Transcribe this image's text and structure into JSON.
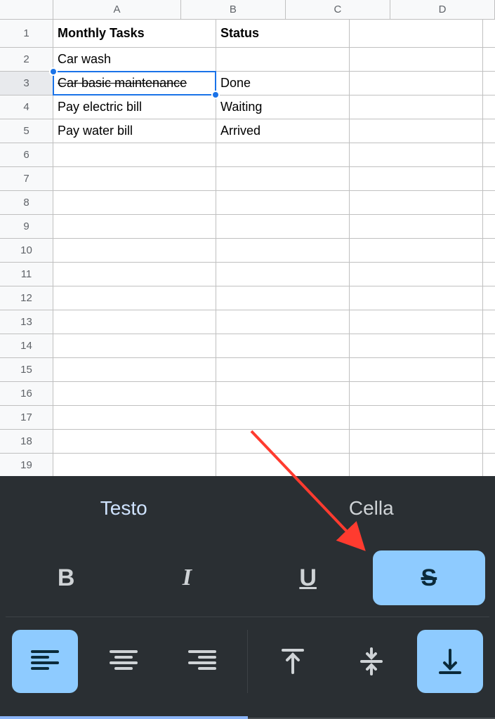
{
  "columns": [
    "A",
    "B",
    "C",
    "D"
  ],
  "row_count": 19,
  "row_height_first": 40,
  "row_height_rest": 34,
  "selected_cell": {
    "row": 3,
    "col": "A"
  },
  "cells": {
    "A1": {
      "text": "Monthly Tasks",
      "bold": true
    },
    "B1": {
      "text": "Status",
      "bold": true
    },
    "A2": {
      "text": "Car wash"
    },
    "A3": {
      "text": "Car basic maintenance",
      "strike": true
    },
    "B3": {
      "text": "Done"
    },
    "A4": {
      "text": "Pay electric bill"
    },
    "B4": {
      "text": "Waiting"
    },
    "A5": {
      "text": "Pay water bill"
    },
    "B5": {
      "text": "Arrived"
    }
  },
  "panel": {
    "tabs": {
      "text": "Testo",
      "cell": "Cella",
      "active": "text"
    },
    "format_buttons": {
      "bold": "B",
      "italic": "I",
      "underline": "U",
      "strike": "S",
      "strike_active": true
    },
    "align_buttons": {
      "h_active": "left",
      "v_active": "bottom"
    }
  },
  "colors": {
    "selection": "#1a73e8",
    "panel_bg": "#2a2f33",
    "accent": "#8ecbff",
    "tab_underline": "#8ab4f8",
    "annotation": "#ff3b2f"
  }
}
